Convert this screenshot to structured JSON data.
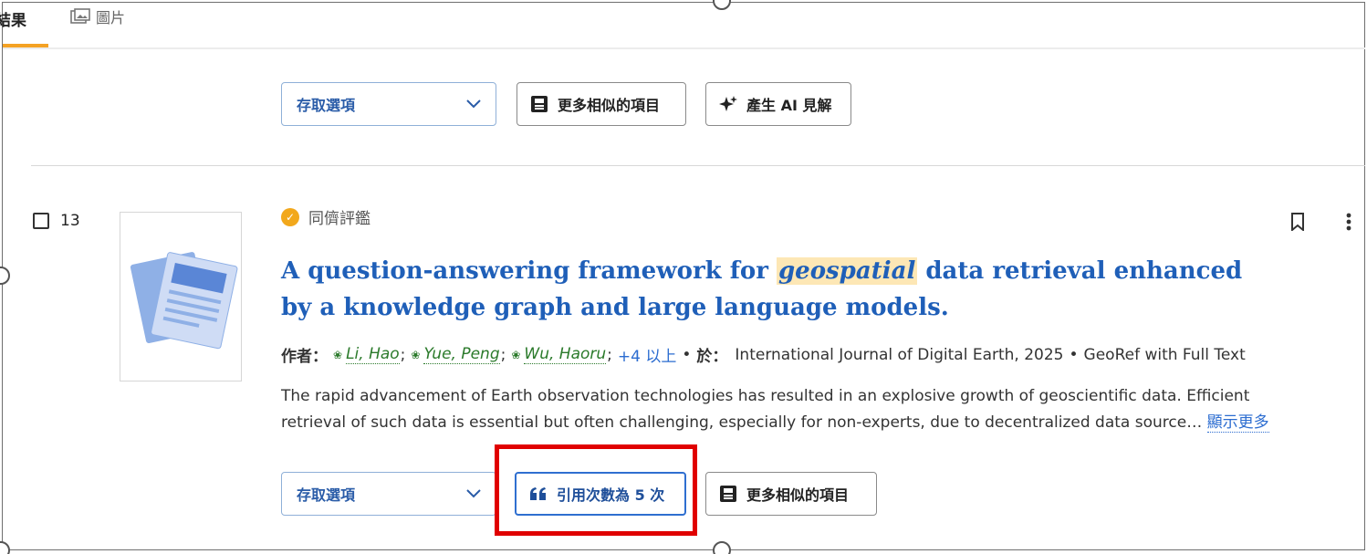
{
  "tabs": {
    "results_label": "結果",
    "images_label": "圖片"
  },
  "top_actions": {
    "access_select": "存取選項",
    "similar_label": "更多相似的項目",
    "ai_label": "產生 AI 見解"
  },
  "result": {
    "number": "13",
    "peer_label": "同儕評鑑",
    "title_before": "A question-answering framework for ",
    "title_highlight": "geospatial",
    "title_after": " data retrieval enhanced by a knowledge graph and large language models.",
    "by_label": "作者：",
    "authors": [
      "Li, Hao",
      "Yue, Peng",
      "Wu, Haoru"
    ],
    "more_authors": "+4 以上",
    "in_label": "於：",
    "journal": "International Journal of Digital Earth, 2025",
    "database": "GeoRef with Full Text",
    "abstract": "The rapid advancement of Earth observation technologies has resulted in an explosive growth of geoscientific data. Efficient retrieval of such data is essential but often challenging, especially for non-experts, due to decentralized data source…",
    "show_more": "顯示更多",
    "access_select": "存取選項",
    "cited_label": "引用次數為 5 次",
    "similar_label": "更多相似的項目"
  },
  "colors": {
    "accent": "#f4a224",
    "link": "#1f5fb8",
    "author": "#2b7a2b",
    "highlight_box": "#e00000"
  }
}
